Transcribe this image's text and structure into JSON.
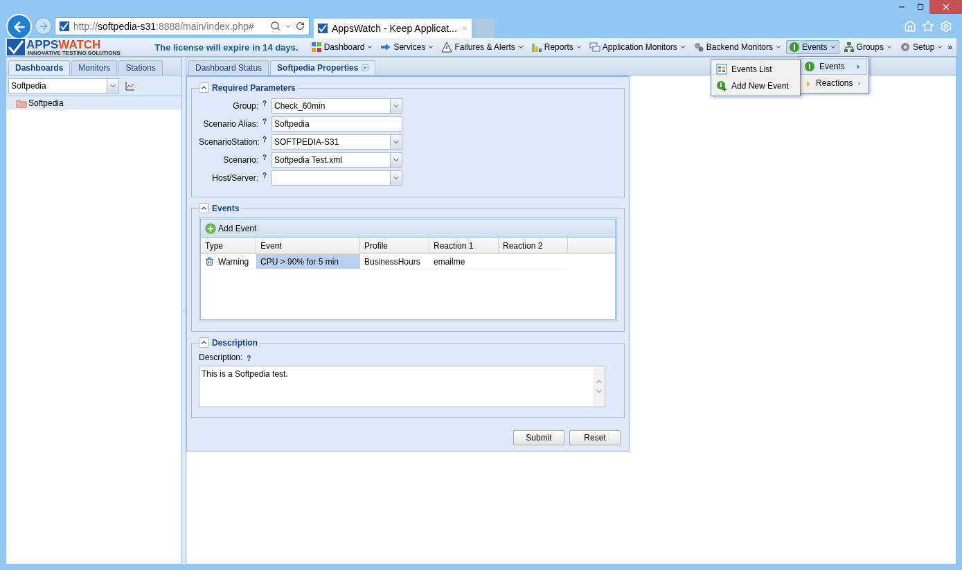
{
  "browser": {
    "url_prefix": "http://",
    "url_host": "softpedia-s31",
    "url_suffix": ":8888/main/index.php#",
    "tab_title": "AppsWatch - Keep Applicat..."
  },
  "header": {
    "logo_left": "APPS",
    "logo_right": "WATCH",
    "tagline": "INNOVATIVE TESTING SOLUTIONS",
    "license": "The license will expire in 14 days.",
    "overflow": "»",
    "menu": [
      {
        "label": "Dashboard",
        "selected": false
      },
      {
        "label": "Services",
        "selected": false
      },
      {
        "label": "Failures & Alerts",
        "selected": false
      },
      {
        "label": "Reports",
        "selected": false
      },
      {
        "label": "Application Monitors",
        "selected": false
      },
      {
        "label": "Backend Monitors",
        "selected": false
      },
      {
        "label": "Events",
        "selected": true
      },
      {
        "label": "Groups",
        "selected": false
      },
      {
        "label": "Setup",
        "selected": false
      }
    ]
  },
  "open_menu": {
    "items": [
      {
        "label": "Events",
        "selected": true
      },
      {
        "label": "Reactions",
        "selected": false
      }
    ],
    "submenu": [
      {
        "label": "Events List"
      },
      {
        "label": "Add New Event"
      }
    ]
  },
  "sidebar": {
    "tabs": [
      {
        "label": "Dashboards",
        "selected": true
      },
      {
        "label": "Monitors",
        "selected": false
      },
      {
        "label": "Stations",
        "selected": false
      }
    ],
    "combo_value": "Softpedia",
    "tree": [
      {
        "label": "Softpedia",
        "selected": true
      }
    ]
  },
  "main": {
    "tabs": [
      {
        "label": "Dashboard Status",
        "selected": false,
        "closable": false
      },
      {
        "label": "Softpedia Properties",
        "selected": true,
        "closable": true
      }
    ],
    "required": {
      "title": "Required Parameters",
      "help": "?",
      "fields": [
        {
          "label": "Group:",
          "value": "Check_60min",
          "kind": "combo"
        },
        {
          "label": "Scenario Alias:",
          "value": "Softpedia",
          "kind": "text"
        },
        {
          "label": "ScenarioStation:",
          "value": "SOFTPEDIA-S31",
          "kind": "combo"
        },
        {
          "label": "Scenario:",
          "value": "Softpedia Test.xml",
          "kind": "combo"
        },
        {
          "label": "Host/Server:",
          "kind": "combo"
        }
      ]
    },
    "events": {
      "title": "Events",
      "add_label": "Add Event",
      "columns": [
        "Type",
        "Event",
        "Profile",
        "Reaction 1",
        "Reaction 2"
      ],
      "rows": [
        {
          "cells": [
            {
              "text": "Warning",
              "selected": false
            },
            {
              "text": "CPU > 90% for 5 min",
              "selected": true
            },
            {
              "text": "BusinessHours",
              "selected": false
            },
            {
              "text": "emailme",
              "selected": false
            },
            {
              "text": "",
              "selected": false
            }
          ]
        }
      ]
    },
    "description": {
      "title": "Description",
      "label": "Description:",
      "help": "?",
      "value": "This is a Softpedia test."
    },
    "buttons": [
      "Submit",
      "Reset"
    ]
  }
}
